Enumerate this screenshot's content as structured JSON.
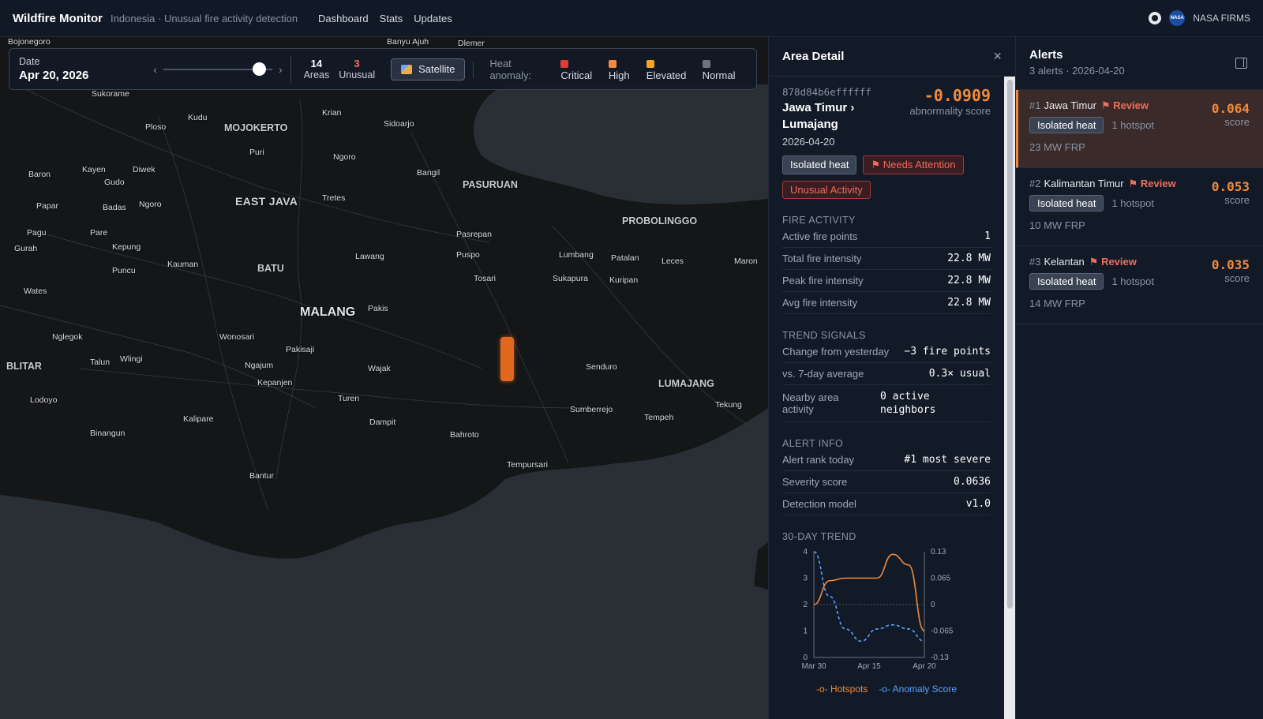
{
  "topbar": {
    "brand": "Wildfire Monitor",
    "subtitle": "Indonesia · Unusual fire activity detection",
    "nav": [
      "Dashboard",
      "Stats",
      "Updates"
    ],
    "nasa_logo": "NASA",
    "source_label": "NASA FIRMS"
  },
  "controls": {
    "date_label": "Date",
    "date_value": "Apr 20, 2026",
    "prev": "‹",
    "next": "›",
    "areas_count": "14",
    "areas_label": "Areas",
    "unusual_count": "3",
    "unusual_label": "Unusual",
    "satellite_label": "Satellite",
    "legend_title": "Heat anomaly:",
    "legend": [
      {
        "label": "Critical",
        "color": "#e03a3a"
      },
      {
        "label": "High",
        "color": "#f08a3c"
      },
      {
        "label": "Elevated",
        "color": "#f5a623"
      },
      {
        "label": "Normal",
        "color": "#6b7280"
      }
    ]
  },
  "map": {
    "labels": [
      {
        "t": "Bojonegoro",
        "c": "normal"
      },
      {
        "t": "Banyu Ajuh",
        "c": "normal"
      },
      {
        "t": "Dlemer",
        "c": "normal"
      },
      {
        "t": "Sukorame",
        "c": "normal"
      },
      {
        "t": "Kudu",
        "c": "normal"
      },
      {
        "t": "Ploso",
        "c": "normal"
      },
      {
        "t": "MOJOKERTO",
        "c": "mid"
      },
      {
        "t": "Krian",
        "c": "normal"
      },
      {
        "t": "Sidoarjo",
        "c": "normal"
      },
      {
        "t": "Puri",
        "c": "normal"
      },
      {
        "t": "Ngoro",
        "c": "normal"
      },
      {
        "t": "Baron",
        "c": "normal"
      },
      {
        "t": "Kayen",
        "c": "normal"
      },
      {
        "t": "Diwek",
        "c": "normal"
      },
      {
        "t": "Gudo",
        "c": "normal"
      },
      {
        "t": "Bangil",
        "c": "normal"
      },
      {
        "t": "Papar",
        "c": "normal"
      },
      {
        "t": "Badas",
        "c": "normal"
      },
      {
        "t": "Ngoro",
        "c": "normal"
      },
      {
        "t": "EAST JAVA",
        "c": "big"
      },
      {
        "t": "Tretes",
        "c": "normal"
      },
      {
        "t": "PASURUAN",
        "c": "mid"
      },
      {
        "t": "PROBOLINGGO",
        "c": "mid"
      },
      {
        "t": "Pagu",
        "c": "normal"
      },
      {
        "t": "Pare",
        "c": "normal"
      },
      {
        "t": "Pasrepan",
        "c": "normal"
      },
      {
        "t": "Gurah",
        "c": "normal"
      },
      {
        "t": "Kepung",
        "c": "normal"
      },
      {
        "t": "Lawang",
        "c": "normal"
      },
      {
        "t": "Puspo",
        "c": "normal"
      },
      {
        "t": "Lumbang",
        "c": "normal"
      },
      {
        "t": "Patalan",
        "c": "normal"
      },
      {
        "t": "Leces",
        "c": "normal"
      },
      {
        "t": "Maron",
        "c": "normal"
      },
      {
        "t": "Kauman",
        "c": "normal"
      },
      {
        "t": "Puncu",
        "c": "normal"
      },
      {
        "t": "BATU",
        "c": "mid"
      },
      {
        "t": "Tosari",
        "c": "normal"
      },
      {
        "t": "Sukapura",
        "c": "normal"
      },
      {
        "t": "Kuripan",
        "c": "normal"
      },
      {
        "t": "Wates",
        "c": "normal"
      },
      {
        "t": "Pakis",
        "c": "normal"
      },
      {
        "t": "MALANG",
        "c": "hot"
      },
      {
        "t": "Nglegok",
        "c": "normal"
      },
      {
        "t": "Wonosari",
        "c": "normal"
      },
      {
        "t": "Pakisaji",
        "c": "normal"
      },
      {
        "t": "Wlingi",
        "c": "normal"
      },
      {
        "t": "BLITAR",
        "c": "mid"
      },
      {
        "t": "Talun",
        "c": "normal"
      },
      {
        "t": "Ngajum",
        "c": "normal"
      },
      {
        "t": "Wajak",
        "c": "normal"
      },
      {
        "t": "Senduro",
        "c": "normal"
      },
      {
        "t": "Kepanjen",
        "c": "normal"
      },
      {
        "t": "LUMAJANG",
        "c": "mid"
      },
      {
        "t": "Lodoyo",
        "c": "normal"
      },
      {
        "t": "Turen",
        "c": "normal"
      },
      {
        "t": "Tekung",
        "c": "normal"
      },
      {
        "t": "Sumberrejo",
        "c": "normal"
      },
      {
        "t": "Kalipare",
        "c": "normal"
      },
      {
        "t": "Dampit",
        "c": "normal"
      },
      {
        "t": "Tempeh",
        "c": "normal"
      },
      {
        "t": "Binangun",
        "c": "normal"
      },
      {
        "t": "Bahroto",
        "c": "normal"
      },
      {
        "t": "Tempursari",
        "c": "normal"
      },
      {
        "t": "Bantur",
        "c": "normal"
      }
    ]
  },
  "detail": {
    "title": "Area Detail",
    "close": "×",
    "hex_id": "878d84b6effffff",
    "score": "-0.0909",
    "score_caption": "abnormality score",
    "place": "Jawa Timur › Lumajang",
    "date": "2026-04-20",
    "tags": [
      {
        "label": "Isolated heat",
        "style": "gray"
      },
      {
        "label": "⚑ Needs Attention",
        "style": "red"
      },
      {
        "label": "Unusual Activity",
        "style": "red"
      }
    ],
    "fire_title": "FIRE ACTIVITY",
    "fire_rows": [
      {
        "k": "Active fire points",
        "v": "1"
      },
      {
        "k": "Total fire intensity",
        "v": "22.8 MW"
      },
      {
        "k": "Peak fire intensity",
        "v": "22.8 MW"
      },
      {
        "k": "Avg fire intensity",
        "v": "22.8 MW"
      }
    ],
    "trend_title": "TREND SIGNALS",
    "trend_rows": [
      {
        "k": "Change from yesterday",
        "v": "−3 fire points"
      },
      {
        "k": "vs. 7-day average",
        "v": "0.3× usual"
      },
      {
        "k": "Nearby area activity",
        "v": "0 active neighbors"
      }
    ],
    "alert_title": "ALERT INFO",
    "alert_rows": [
      {
        "k": "Alert rank today",
        "v": "#1 most severe"
      },
      {
        "k": "Severity score",
        "v": "0.0636"
      },
      {
        "k": "Detection model",
        "v": "v1.0"
      }
    ],
    "chart_title": "30-DAY TREND",
    "legend_hotspots": "Hotspots",
    "legend_anomaly": "Anomaly Score"
  },
  "chart_data": {
    "type": "line",
    "title": "30-DAY TREND",
    "x_ticks": [
      "Mar 30",
      "Apr 15",
      "Apr 20"
    ],
    "x": [
      "Mar 30",
      "Apr 2",
      "Apr 6",
      "Apr 10",
      "Apr 15",
      "Apr 17",
      "Apr 19",
      "Apr 20"
    ],
    "y_left_ticks": [
      "0",
      "1",
      "2",
      "3",
      "4"
    ],
    "y_right_ticks": [
      "-0.13",
      "-0.065",
      "0",
      "0.065",
      "0.13"
    ],
    "ylim_left": [
      0,
      4
    ],
    "ylim_right": [
      -0.13,
      0.13
    ],
    "series": [
      {
        "name": "Hotspots",
        "axis": "left",
        "color": "#f08a3c",
        "dash": false,
        "values": [
          2,
          2.9,
          3,
          3,
          3,
          3.9,
          3.5,
          1
        ]
      },
      {
        "name": "Anomaly Score",
        "axis": "right",
        "color": "#5aa0ff",
        "dash": true,
        "values": [
          0.13,
          0.02,
          -0.06,
          -0.09,
          -0.06,
          -0.05,
          -0.06,
          -0.09
        ]
      }
    ],
    "grid": false,
    "legend_position": "bottom"
  },
  "alerts": {
    "title": "Alerts",
    "subtitle": "3 alerts · 2026-04-20",
    "items": [
      {
        "rank": "#1",
        "region": "Jawa Timur",
        "review": "⚑ Review",
        "pill": "Isolated heat",
        "hotspots": "1 hotspot",
        "frp": "23 MW FRP",
        "score": "0.064",
        "score_label": "score"
      },
      {
        "rank": "#2",
        "region": "Kalimantan Timur",
        "review": "⚑ Review",
        "pill": "Isolated heat",
        "hotspots": "1 hotspot",
        "frp": "10 MW FRP",
        "score": "0.053",
        "score_label": "score"
      },
      {
        "rank": "#3",
        "region": "Kelantan",
        "review": "⚑ Review",
        "pill": "Isolated heat",
        "hotspots": "1 hotspot",
        "frp": "14 MW FRP",
        "score": "0.035",
        "score_label": "score"
      }
    ]
  }
}
